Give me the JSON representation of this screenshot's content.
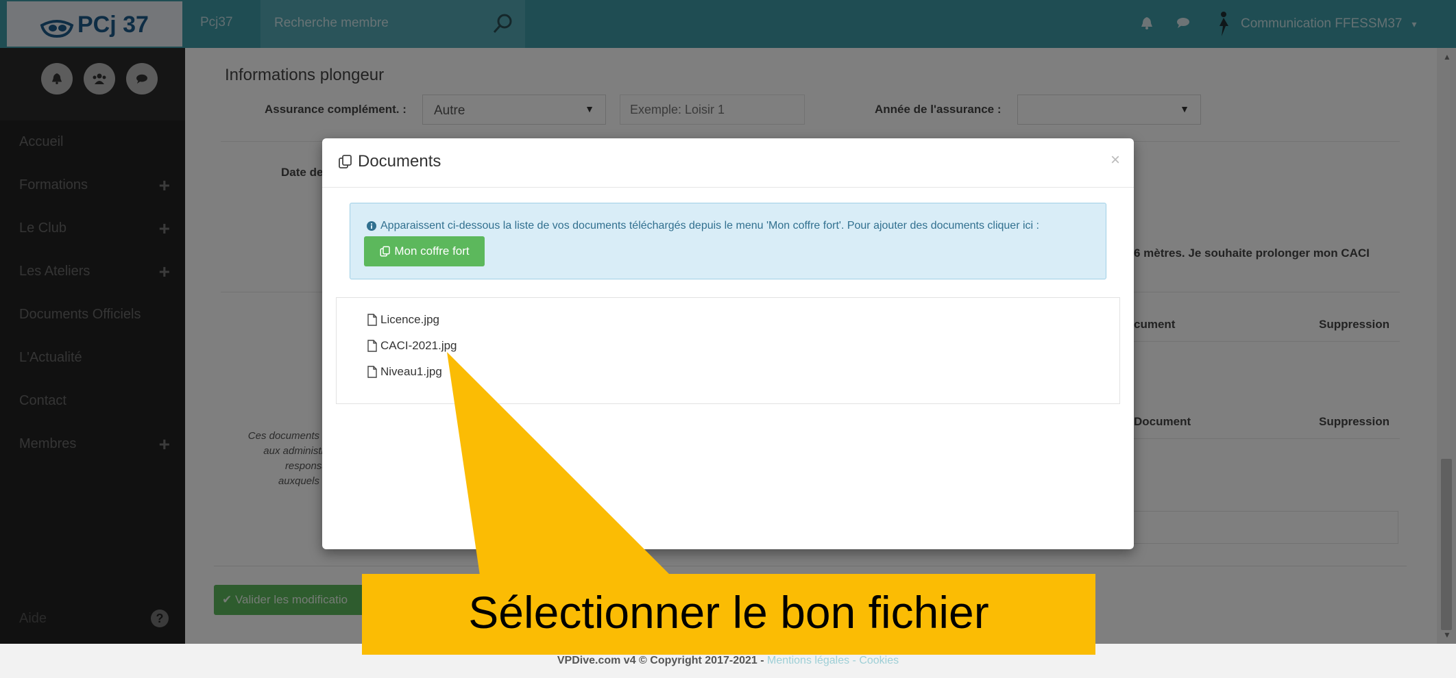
{
  "header": {
    "logo_text": "PCj 37",
    "brand": "Pcj37",
    "search_placeholder": "Recherche membre",
    "user_name": "Communication FFESSM37"
  },
  "sidebar": {
    "items": [
      {
        "label": "Accueil",
        "has_plus": false
      },
      {
        "label": "Formations",
        "has_plus": true
      },
      {
        "label": "Le Club",
        "has_plus": true
      },
      {
        "label": "Les Ateliers",
        "has_plus": true
      },
      {
        "label": "Documents Officiels",
        "has_plus": false
      },
      {
        "label": "L'Actualité",
        "has_plus": false
      },
      {
        "label": "Contact",
        "has_plus": false
      },
      {
        "label": "Membres",
        "has_plus": true
      }
    ],
    "plus_symbol": "+",
    "help_label": "Aide",
    "help_icon": "?"
  },
  "main": {
    "section_title": "Informations plongeur",
    "assurance_label": "Assurance complément. :",
    "assurance_value": "Autre",
    "assurance_example_placeholder": "Exemple: Loisir 1",
    "annee_label": "Année de l'assurance :",
    "annee_value": "",
    "date_label": "Date de",
    "caci_text": "6 mètres. Je souhaite prolonger mon CACI",
    "col_document_1": "cument",
    "col_suppression_1": "Suppression",
    "col_document_2": "Document",
    "col_suppression_2": "Suppression",
    "side_note_lines": [
      "Ces documents se",
      "aux administrat",
      "responsab",
      "auxquels vo"
    ],
    "validate_button": "Valider les modificatio"
  },
  "modal": {
    "title": "Documents",
    "close": "×",
    "info_text": "Apparaissent ci-dessous la liste de vos documents téléchargés depuis le menu 'Mon coffre fort'. Pour ajouter des documents cliquer ici :",
    "coffre_button": "Mon coffre fort",
    "documents": [
      "Licence.jpg",
      "CACI-2021.jpg",
      "Niveau1.jpg"
    ]
  },
  "footer": {
    "text": "VPDive.com v4 © Copyright 2017-2021 - ",
    "mentions": "Mentions légales",
    "sep": " - ",
    "cookies": "Cookies"
  },
  "callout": {
    "text": "Sélectionner le bon fichier"
  },
  "colors": {
    "navbar": "#3f9aa7",
    "sidebar": "#222222",
    "success": "#5cb85c",
    "info_bg": "#d9edf7",
    "callout": "#fbbc04"
  }
}
